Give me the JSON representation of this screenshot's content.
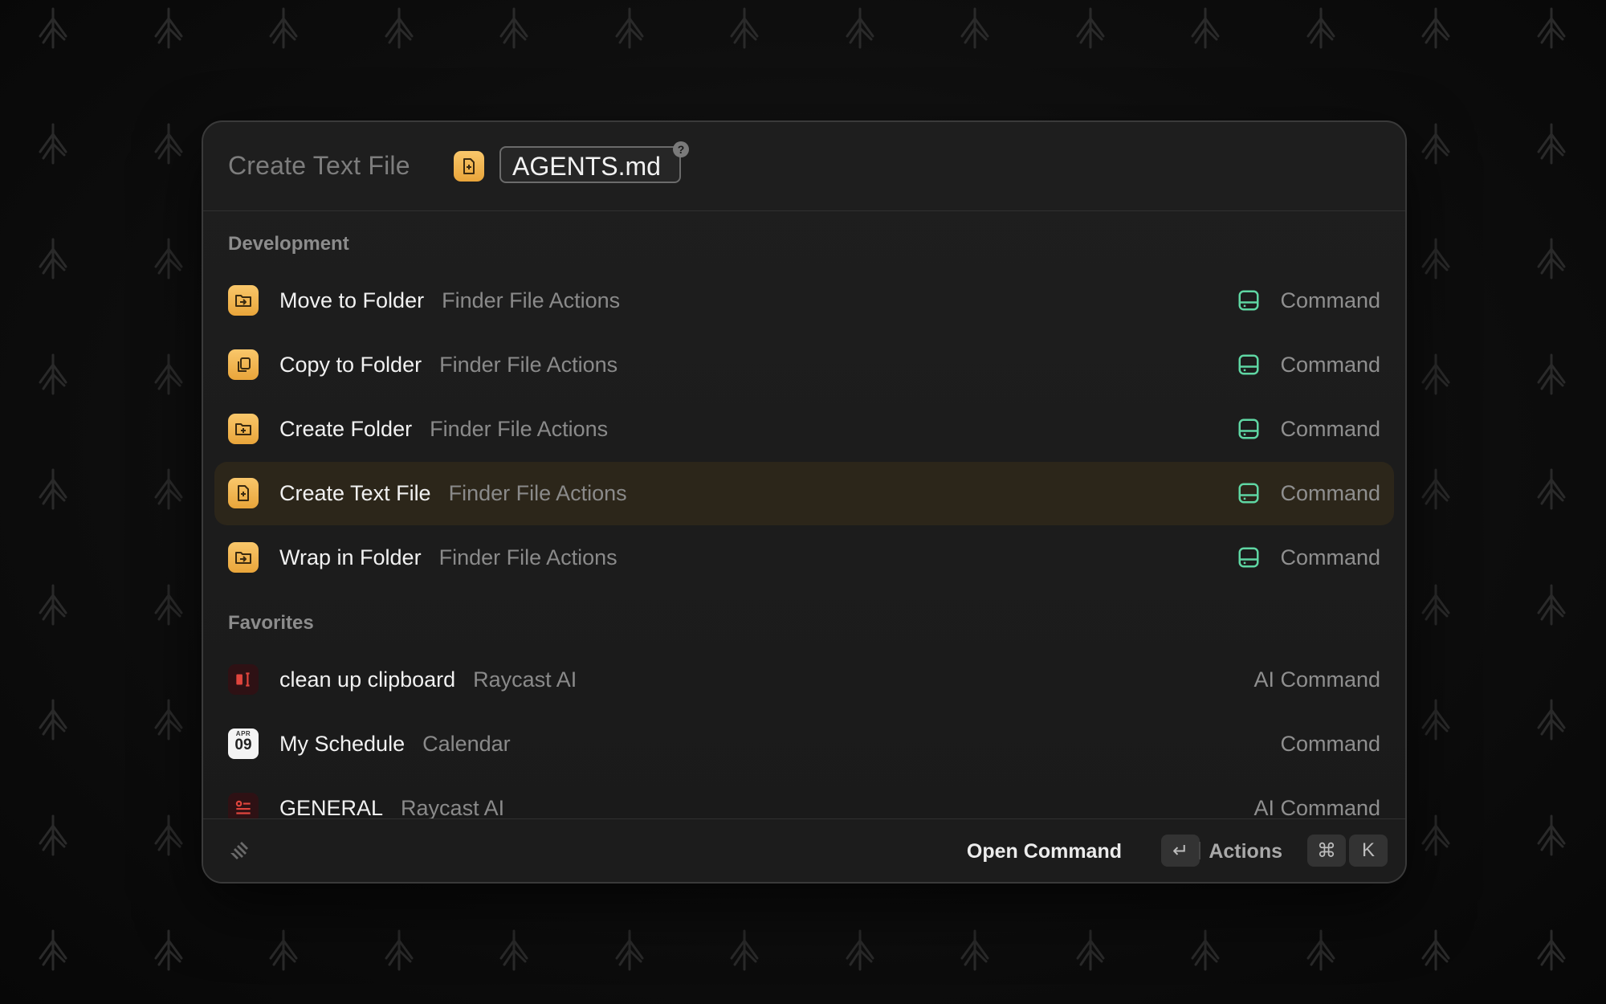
{
  "header": {
    "command_title": "Create Text File",
    "argument_value": "AGENTS.md",
    "help_label": "?"
  },
  "sections": [
    {
      "title": "Development",
      "items": [
        {
          "title": "Move to Folder",
          "subtitle": "Finder File Actions",
          "accessory": "Command",
          "icon": "folder-move-icon"
        },
        {
          "title": "Copy to Folder",
          "subtitle": "Finder File Actions",
          "accessory": "Command",
          "icon": "copy-icon"
        },
        {
          "title": "Create Folder",
          "subtitle": "Finder File Actions",
          "accessory": "Command",
          "icon": "folder-plus-icon"
        },
        {
          "title": "Create Text File",
          "subtitle": "Finder File Actions",
          "accessory": "Command",
          "icon": "file-plus-icon",
          "selected": true
        },
        {
          "title": "Wrap in Folder",
          "subtitle": "Finder File Actions",
          "accessory": "Command",
          "icon": "folder-move-icon"
        }
      ]
    },
    {
      "title": "Favorites",
      "items": [
        {
          "title": "clean up clipboard",
          "subtitle": "Raycast AI",
          "accessory": "AI Command",
          "icon": "text-cursor-icon"
        },
        {
          "title": "My Schedule",
          "subtitle": "Calendar",
          "accessory": "Command",
          "icon": "calendar-icon",
          "calendar_month": "APR",
          "calendar_day": "09"
        },
        {
          "title": "GENERAL",
          "subtitle": "Raycast AI",
          "accessory": "AI Command",
          "icon": "list-icon"
        }
      ]
    }
  ],
  "footer": {
    "primary_action": "Open Command",
    "primary_key": "↵",
    "actions_label": "Actions",
    "actions_keys": [
      "⌘",
      "K"
    ]
  },
  "colors": {
    "accent": "#f5b74a",
    "extension_icon": "#5fd6a3",
    "selected_row": "#2c261a"
  }
}
